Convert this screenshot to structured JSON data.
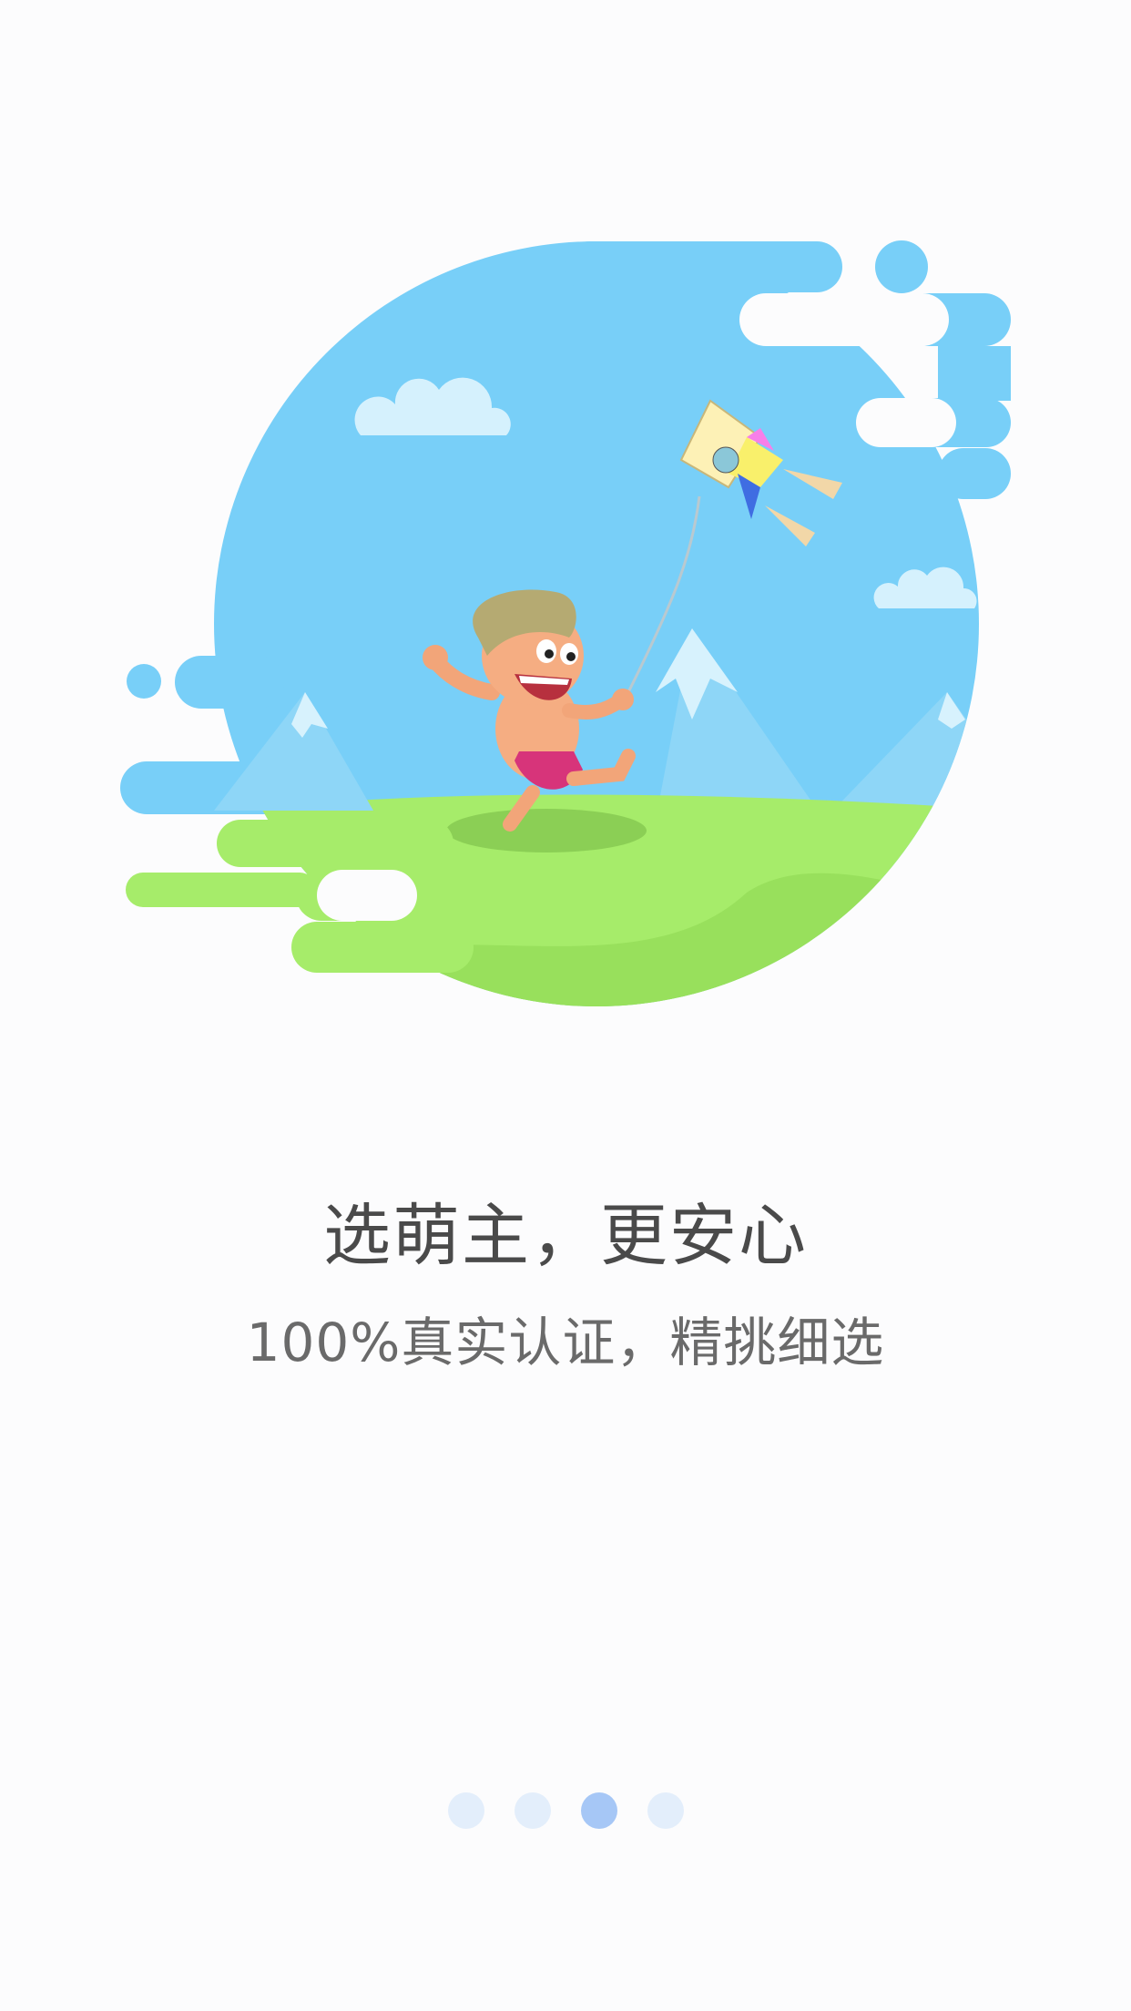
{
  "onboarding": {
    "title": "选萌主，更安心",
    "subtitle": "100%真实认证，精挑细选",
    "illustration": {
      "name": "boy-flying-kite-illustration",
      "sky_color": "#78cff8",
      "grass_color": "#a6ec6a"
    },
    "pager": {
      "total": 4,
      "current": 3,
      "dot_color": "#e3eefb",
      "active_color": "#a6c7f6"
    }
  }
}
